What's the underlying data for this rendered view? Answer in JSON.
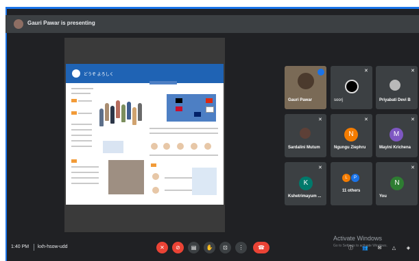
{
  "meeting": {
    "presenter": "Gauri Pawar is presenting",
    "time": "1:40 PM",
    "code": "kxh-hsow-udd"
  },
  "slide": {
    "title": "どうぞ よろしく"
  },
  "participants": [
    {
      "name": "Gauri Pawar"
    },
    {
      "name": "soorj"
    },
    {
      "name": "Priyabati Devi B"
    },
    {
      "name": "Sardalini Mutum"
    },
    {
      "name": "Ngungu Ziephru",
      "initial": "N"
    },
    {
      "name": "Mayini Krichena",
      "initial": "M"
    },
    {
      "name": "Kshetrimayum ...",
      "initial": "K"
    },
    {
      "name": "11 others",
      "initial1": "L",
      "initial2": "P"
    },
    {
      "name": "You",
      "initial": "N"
    }
  ],
  "watermark": {
    "line1": "Activate Windows",
    "line2": "Go to Settings to activate Windows."
  },
  "colors": {
    "accent": "#1a73e8",
    "danger": "#ea4335",
    "background": "#202124"
  },
  "icons": [
    "mic-off-icon",
    "camera-off-icon",
    "captions-icon",
    "hand-icon",
    "present-icon",
    "more-icon",
    "end-call-icon"
  ]
}
